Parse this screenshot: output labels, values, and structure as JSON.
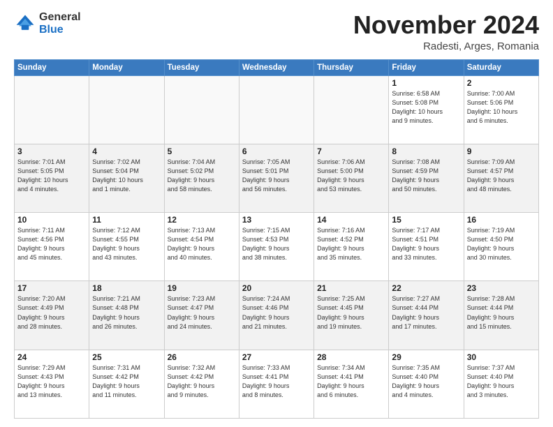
{
  "logo": {
    "general": "General",
    "blue": "Blue"
  },
  "header": {
    "month": "November 2024",
    "location": "Radesti, Arges, Romania"
  },
  "weekdays": [
    "Sunday",
    "Monday",
    "Tuesday",
    "Wednesday",
    "Thursday",
    "Friday",
    "Saturday"
  ],
  "weeks": [
    [
      {
        "day": "",
        "info": ""
      },
      {
        "day": "",
        "info": ""
      },
      {
        "day": "",
        "info": ""
      },
      {
        "day": "",
        "info": ""
      },
      {
        "day": "",
        "info": ""
      },
      {
        "day": "1",
        "info": "Sunrise: 6:58 AM\nSunset: 5:08 PM\nDaylight: 10 hours\nand 9 minutes."
      },
      {
        "day": "2",
        "info": "Sunrise: 7:00 AM\nSunset: 5:06 PM\nDaylight: 10 hours\nand 6 minutes."
      }
    ],
    [
      {
        "day": "3",
        "info": "Sunrise: 7:01 AM\nSunset: 5:05 PM\nDaylight: 10 hours\nand 4 minutes."
      },
      {
        "day": "4",
        "info": "Sunrise: 7:02 AM\nSunset: 5:04 PM\nDaylight: 10 hours\nand 1 minute."
      },
      {
        "day": "5",
        "info": "Sunrise: 7:04 AM\nSunset: 5:02 PM\nDaylight: 9 hours\nand 58 minutes."
      },
      {
        "day": "6",
        "info": "Sunrise: 7:05 AM\nSunset: 5:01 PM\nDaylight: 9 hours\nand 56 minutes."
      },
      {
        "day": "7",
        "info": "Sunrise: 7:06 AM\nSunset: 5:00 PM\nDaylight: 9 hours\nand 53 minutes."
      },
      {
        "day": "8",
        "info": "Sunrise: 7:08 AM\nSunset: 4:59 PM\nDaylight: 9 hours\nand 50 minutes."
      },
      {
        "day": "9",
        "info": "Sunrise: 7:09 AM\nSunset: 4:57 PM\nDaylight: 9 hours\nand 48 minutes."
      }
    ],
    [
      {
        "day": "10",
        "info": "Sunrise: 7:11 AM\nSunset: 4:56 PM\nDaylight: 9 hours\nand 45 minutes."
      },
      {
        "day": "11",
        "info": "Sunrise: 7:12 AM\nSunset: 4:55 PM\nDaylight: 9 hours\nand 43 minutes."
      },
      {
        "day": "12",
        "info": "Sunrise: 7:13 AM\nSunset: 4:54 PM\nDaylight: 9 hours\nand 40 minutes."
      },
      {
        "day": "13",
        "info": "Sunrise: 7:15 AM\nSunset: 4:53 PM\nDaylight: 9 hours\nand 38 minutes."
      },
      {
        "day": "14",
        "info": "Sunrise: 7:16 AM\nSunset: 4:52 PM\nDaylight: 9 hours\nand 35 minutes."
      },
      {
        "day": "15",
        "info": "Sunrise: 7:17 AM\nSunset: 4:51 PM\nDaylight: 9 hours\nand 33 minutes."
      },
      {
        "day": "16",
        "info": "Sunrise: 7:19 AM\nSunset: 4:50 PM\nDaylight: 9 hours\nand 30 minutes."
      }
    ],
    [
      {
        "day": "17",
        "info": "Sunrise: 7:20 AM\nSunset: 4:49 PM\nDaylight: 9 hours\nand 28 minutes."
      },
      {
        "day": "18",
        "info": "Sunrise: 7:21 AM\nSunset: 4:48 PM\nDaylight: 9 hours\nand 26 minutes."
      },
      {
        "day": "19",
        "info": "Sunrise: 7:23 AM\nSunset: 4:47 PM\nDaylight: 9 hours\nand 24 minutes."
      },
      {
        "day": "20",
        "info": "Sunrise: 7:24 AM\nSunset: 4:46 PM\nDaylight: 9 hours\nand 21 minutes."
      },
      {
        "day": "21",
        "info": "Sunrise: 7:25 AM\nSunset: 4:45 PM\nDaylight: 9 hours\nand 19 minutes."
      },
      {
        "day": "22",
        "info": "Sunrise: 7:27 AM\nSunset: 4:44 PM\nDaylight: 9 hours\nand 17 minutes."
      },
      {
        "day": "23",
        "info": "Sunrise: 7:28 AM\nSunset: 4:44 PM\nDaylight: 9 hours\nand 15 minutes."
      }
    ],
    [
      {
        "day": "24",
        "info": "Sunrise: 7:29 AM\nSunset: 4:43 PM\nDaylight: 9 hours\nand 13 minutes."
      },
      {
        "day": "25",
        "info": "Sunrise: 7:31 AM\nSunset: 4:42 PM\nDaylight: 9 hours\nand 11 minutes."
      },
      {
        "day": "26",
        "info": "Sunrise: 7:32 AM\nSunset: 4:42 PM\nDaylight: 9 hours\nand 9 minutes."
      },
      {
        "day": "27",
        "info": "Sunrise: 7:33 AM\nSunset: 4:41 PM\nDaylight: 9 hours\nand 8 minutes."
      },
      {
        "day": "28",
        "info": "Sunrise: 7:34 AM\nSunset: 4:41 PM\nDaylight: 9 hours\nand 6 minutes."
      },
      {
        "day": "29",
        "info": "Sunrise: 7:35 AM\nSunset: 4:40 PM\nDaylight: 9 hours\nand 4 minutes."
      },
      {
        "day": "30",
        "info": "Sunrise: 7:37 AM\nSunset: 4:40 PM\nDaylight: 9 hours\nand 3 minutes."
      }
    ]
  ]
}
